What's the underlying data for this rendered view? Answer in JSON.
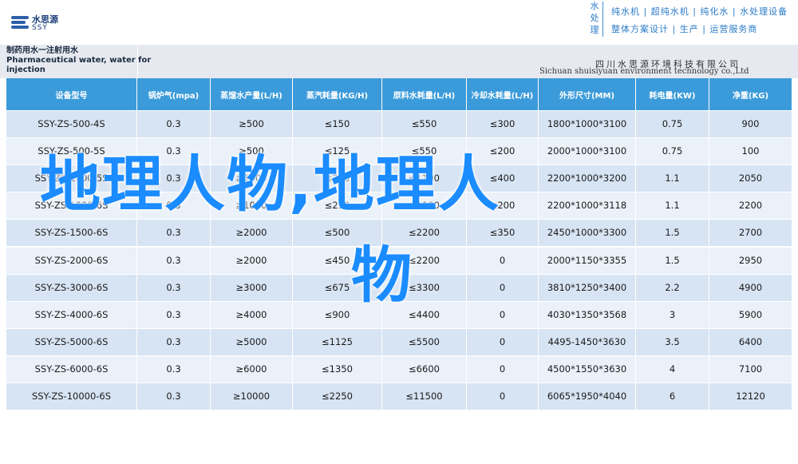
{
  "header": {
    "logo_cn": "水思源",
    "logo_en": "SSY",
    "slogan_vertical": [
      "水",
      "处",
      "理"
    ],
    "slogan_line1": "纯水机 | 超纯水机 | 纯化水 | 水处理设备",
    "slogan_line2": "整体方案设计 | 生产 | 运营服务商"
  },
  "titleband": {
    "title_cn": "制药用水一注射用水",
    "title_en_1": "Pharmaceutical water, water for",
    "title_en_2": "injection",
    "company_cn": "四川水思源环境科技有限公司",
    "company_en": "Sichuan shuisiyuan environment technology co.,Ltd"
  },
  "table": {
    "headers": [
      "设备型号",
      "锅炉气(mpa)",
      "蒸馏水产量(L/H)",
      "蒸汽耗量(KG/H)",
      "原料水耗量(L/H)",
      "冷却水耗量(L/H)",
      "外形尺寸(MM)",
      "耗电量(KW)",
      "净重(KG)"
    ],
    "rows": [
      [
        "SSY-ZS-500-4S",
        "0.3",
        "≥500",
        "≤150",
        "≤550",
        "≤300",
        "1800*1000*3100",
        "0.75",
        "900"
      ],
      [
        "SSY-ZS-500-5S",
        "0.3",
        "≥500",
        "≤125",
        "≤550",
        "≤200",
        "2000*1000*3100",
        "0.75",
        "100"
      ],
      [
        "SSY-ZS-1000-5S",
        "0.3",
        "≥1000",
        "≤250",
        "≤1100",
        "≤400",
        "2200*1000*3200",
        "1.1",
        "2050"
      ],
      [
        "SSY-ZS-1000-6S",
        "0.3",
        "≥1000",
        "≤210",
        "≤1100",
        "≤200",
        "2200*1000*3118",
        "1.1",
        "2200"
      ],
      [
        "SSY-ZS-1500-6S",
        "0.3",
        "≥2000",
        "≤500",
        "≤2200",
        "≤350",
        "2450*1000*3300",
        "1.5",
        "2700"
      ],
      [
        "SSY-ZS-2000-6S",
        "0.3",
        "≥2000",
        "≤450",
        "≤2200",
        "0",
        "2000*1150*3355",
        "1.5",
        "2950"
      ],
      [
        "SSY-ZS-3000-6S",
        "0.3",
        "≥3000",
        "≤675",
        "≤3300",
        "0",
        "3810*1250*3400",
        "2.2",
        "4900"
      ],
      [
        "SSY-ZS-4000-6S",
        "0.3",
        "≥4000",
        "≤900",
        "≤4400",
        "0",
        "4030*1350*3568",
        "3",
        "5900"
      ],
      [
        "SSY-ZS-5000-6S",
        "0.3",
        "≥5000",
        "≤1125",
        "≤5500",
        "0",
        "4495-1450*3630",
        "3.5",
        "6400"
      ],
      [
        "SSY-ZS-6000-6S",
        "0.3",
        "≥6000",
        "≤1350",
        "≤6600",
        "0",
        "4500*1550*3630",
        "4",
        "7100"
      ],
      [
        "SSY-ZS-10000-6S",
        "0.3",
        "≥10000",
        "≤2250",
        "≤11500",
        "0",
        "6065*1950*4040",
        "6",
        "12120"
      ]
    ]
  },
  "overlay": {
    "line1": "地理人物,地理人",
    "line2": "物"
  },
  "colors": {
    "header_row": "#3b9bda",
    "row_odd": "#d7e4f3",
    "row_even": "#eaf1f9",
    "overlay_text": "#1a8cff",
    "brand": "#2b7bc8"
  }
}
